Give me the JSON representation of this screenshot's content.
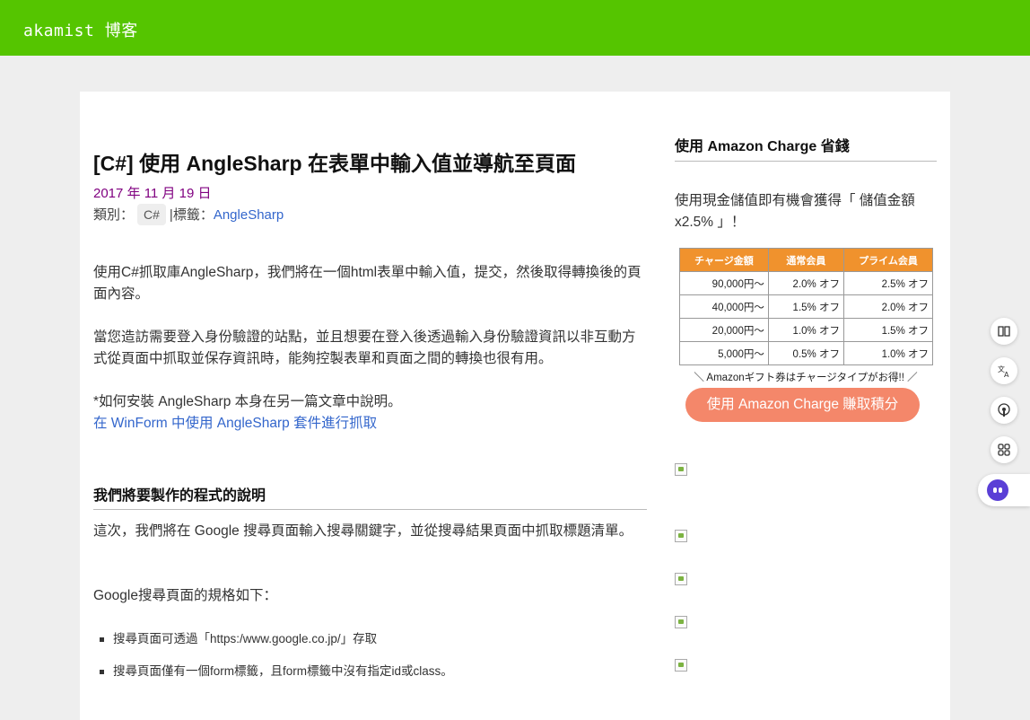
{
  "header": {
    "site_title": "akamist 博客"
  },
  "article": {
    "title": "[C#] 使用 AngleSharp 在表單中輸入值並導航至頁面",
    "date": "2017 年 11 月 19 日",
    "category_label": "類別：",
    "category": "C#",
    "tag_label": "|標籤：",
    "tag": "AngleSharp",
    "p1": "使用C#抓取庫AngleSharp，我們將在一個html表單中輸入值，提交，然後取得轉換後的頁面內容。",
    "p2": "當您造訪需要登入身份驗證的站點，並且想要在登入後透過輸入身份驗證資訊以非互動方式從頁面中抓取並保存資訊時，能夠控製表單和頁面之間的轉換也很有用。",
    "p3_text": "*如何安裝 AngleSharp 本身在另一篇文章中說明。",
    "p3_link": "在 WinForm 中使用 AngleSharp 套件進行抓取",
    "section_heading": "我們將要製作的程式的說明",
    "p4": "這次，我們將在 Google 搜尋頁面輸入搜尋關鍵字，並從搜尋結果頁面中抓取標題清單。",
    "p5": "Google搜尋頁面的規格如下：",
    "bullets": [
      "搜尋頁面可透過「https:/www.google.co.jp/」存取",
      "搜尋頁面僅有一個form標籤，且form標籤中沒有指定id或class。"
    ]
  },
  "sidebar": {
    "heading": "使用 Amazon Charge 省錢",
    "text": "使用現金儲值即有機會獲得「 儲值金額x2.5% 」！",
    "table": {
      "headers": [
        "チャージ金額",
        "通常会員",
        "プライム会員"
      ],
      "rows": [
        [
          "90,000円〜",
          "2.0% オフ",
          "2.5% オフ"
        ],
        [
          "40,000円〜",
          "1.5% オフ",
          "2.0% オフ"
        ],
        [
          "20,000円〜",
          "1.0% オフ",
          "1.5% オフ"
        ],
        [
          "5,000円〜",
          "0.5% オフ",
          "1.0% オフ"
        ]
      ]
    },
    "gift_note": "＼ Amazonギフト券はチャージタイプがお得!! ／",
    "button_label": "使用 Amazon Charge 賺取積分"
  },
  "dock": {
    "icons": [
      "book-icon",
      "translate-icon",
      "podcast-icon",
      "apps-icon",
      "assistant-bot-icon"
    ]
  },
  "colors": {
    "header_bg": "#55c500",
    "date": "#800080",
    "link": "#3366cc",
    "table_header": "#f0922d",
    "button": "#f4876a"
  }
}
